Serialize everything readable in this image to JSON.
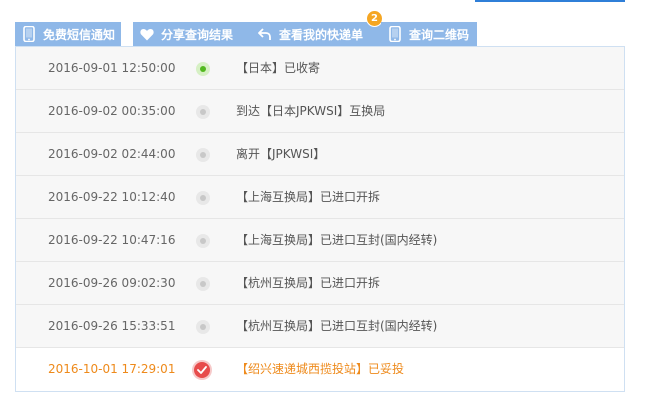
{
  "toolbar": {
    "sms_notify_label": "免费短信通知",
    "share_label": "分享查询结果",
    "my_express_label": "查看我的快递单",
    "my_express_badge": "2",
    "qrcode_label": "查询二维码"
  },
  "colors": {
    "button_bg": "#8fb8e8",
    "badge_bg": "#f5a623",
    "latest_text": "#ee8a1b",
    "first_dot": "#52b81f",
    "latest_dot": "#e74c4c"
  },
  "tracking": {
    "rows": [
      {
        "time": "2016-09-01 12:50:00",
        "desc": "【日本】已收寄"
      },
      {
        "time": "2016-09-02 00:35:00",
        "desc": "到达【日本JPKWSI】互换局"
      },
      {
        "time": "2016-09-02 02:44:00",
        "desc": "离开【JPKWSI】"
      },
      {
        "time": "2016-09-22 10:12:40",
        "desc": "【上海互换局】已进口开拆"
      },
      {
        "time": "2016-09-22 10:47:16",
        "desc": "【上海互换局】已进口互封(国内经转)"
      },
      {
        "time": "2016-09-26 09:02:30",
        "desc": "【杭州互换局】已进口开拆"
      },
      {
        "time": "2016-09-26 15:33:51",
        "desc": "【杭州互换局】已进口互封(国内经转)"
      },
      {
        "time": "2016-10-01 17:29:01",
        "desc": "【绍兴速递城西揽投站】已妥投"
      }
    ]
  }
}
